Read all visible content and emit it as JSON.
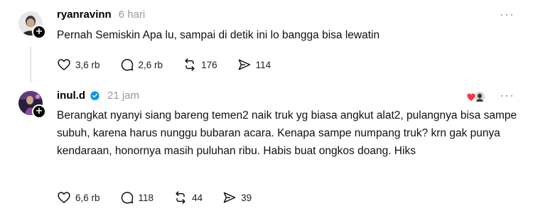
{
  "posts": [
    {
      "username": "ryanravinn",
      "time": "6 hari",
      "text": "Pernah Semiskin Apa lu, sampai di detik ini lo bangga bisa lewatin",
      "more": "···",
      "actions": {
        "likes": "3,6 rb",
        "replies": "2,6 rb",
        "reposts": "176",
        "shares": "114"
      }
    },
    {
      "username": "inul.d",
      "time": "21 jam",
      "verified": true,
      "text": "Berangkat nyanyi siang bareng temen2 naik truk yg biasa angkut alat2, pulangnya bisa sampe subuh, karena harus nunggu bubaran acara. Kenapa sampe numpang truk? krn gak punya kendaraan, honornya masih puluhan ribu. Habis buat ongkos doang. Hiks",
      "more": "···",
      "actions": {
        "likes": "6,6 rb",
        "replies": "118",
        "reposts": "44",
        "shares": "39"
      }
    }
  ],
  "colors": {
    "verified": "#0095f6",
    "muted": "#999999",
    "heart_badge": "#ff3040"
  }
}
